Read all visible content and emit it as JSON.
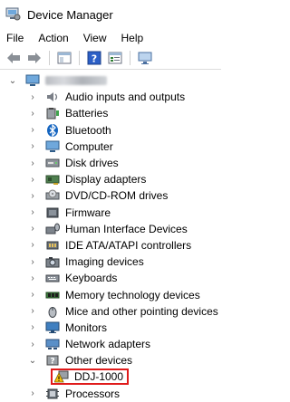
{
  "window": {
    "title": "Device Manager"
  },
  "menu": {
    "items": [
      "File",
      "Action",
      "View",
      "Help"
    ]
  },
  "tree": {
    "root": {
      "label": "",
      "label_redacted": true
    },
    "categories": [
      {
        "label": "Audio inputs and outputs",
        "icon": "speaker-icon"
      },
      {
        "label": "Batteries",
        "icon": "battery-icon"
      },
      {
        "label": "Bluetooth",
        "icon": "bluetooth-icon"
      },
      {
        "label": "Computer",
        "icon": "computer-icon"
      },
      {
        "label": "Disk drives",
        "icon": "disk-drive-icon"
      },
      {
        "label": "Display adapters",
        "icon": "display-adapter-icon"
      },
      {
        "label": "DVD/CD-ROM drives",
        "icon": "dvd-drive-icon"
      },
      {
        "label": "Firmware",
        "icon": "firmware-icon"
      },
      {
        "label": "Human Interface Devices",
        "icon": "hid-icon"
      },
      {
        "label": "IDE ATA/ATAPI controllers",
        "icon": "ide-controller-icon"
      },
      {
        "label": "Imaging devices",
        "icon": "camera-icon"
      },
      {
        "label": "Keyboards",
        "icon": "keyboard-icon"
      },
      {
        "label": "Memory technology devices",
        "icon": "memory-icon"
      },
      {
        "label": "Mice and other pointing devices",
        "icon": "mouse-icon"
      },
      {
        "label": "Monitors",
        "icon": "monitor-icon"
      },
      {
        "label": "Network adapters",
        "icon": "network-adapter-icon"
      },
      {
        "label": "Other devices",
        "icon": "other-devices-icon",
        "expanded": true,
        "children": [
          {
            "label": "DDJ-1000",
            "icon": "warning-device-icon",
            "highlighted": true
          }
        ]
      },
      {
        "label": "Processors",
        "icon": "processor-icon"
      }
    ]
  },
  "colors": {
    "highlight_border": "#e01b1b",
    "warning": "#f4c20d"
  }
}
